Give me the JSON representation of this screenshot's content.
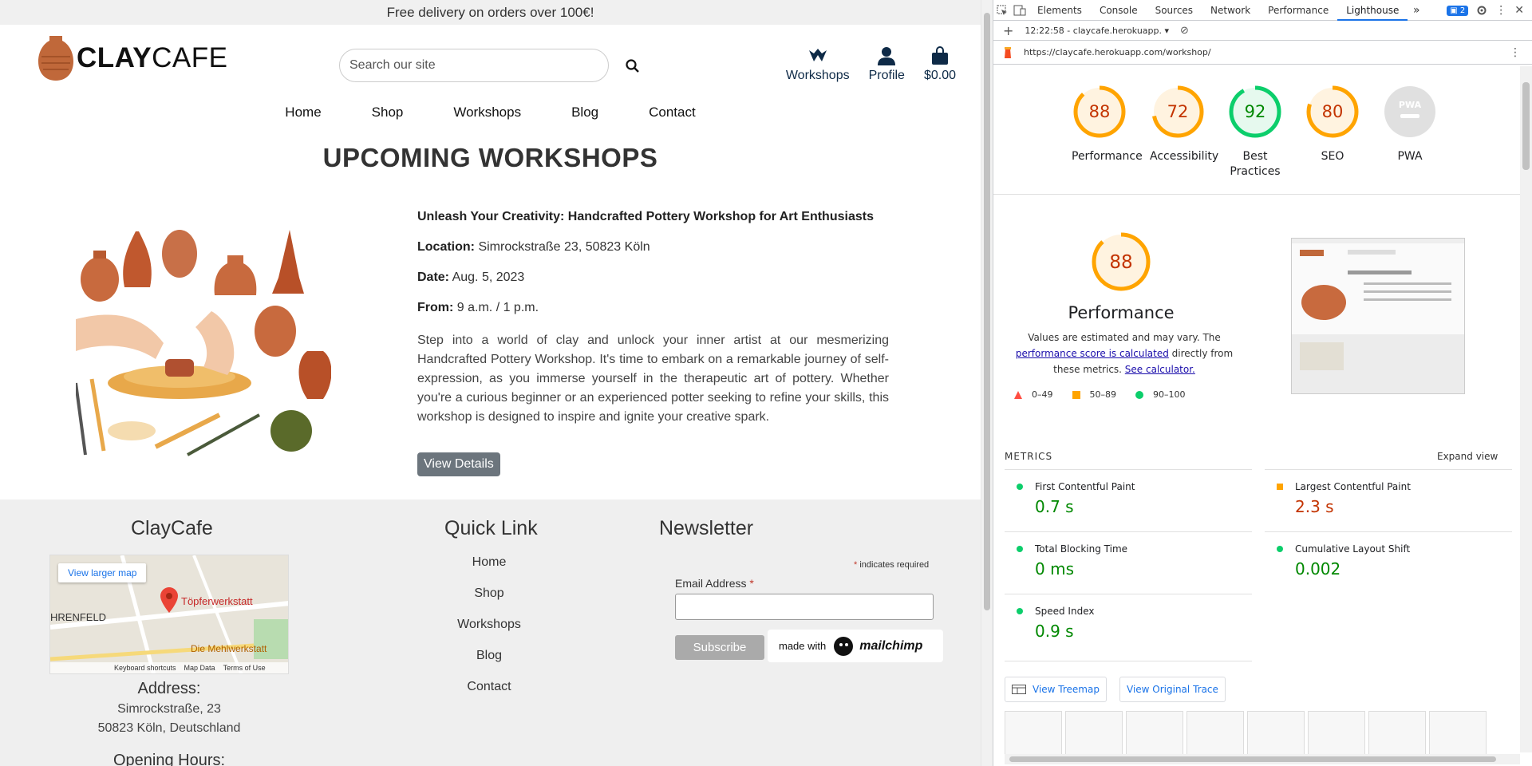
{
  "site": {
    "banner": "Free delivery on orders over 100€!",
    "logo": {
      "bold": "CLAY",
      "light": "CAFE"
    },
    "search": {
      "placeholder": "Search our site"
    },
    "nav_icons": [
      {
        "label": "Workshops",
        "icon": "pottery-icon"
      },
      {
        "label": "Profile",
        "icon": "user-icon"
      },
      {
        "label": "$0.00",
        "icon": "bag-icon"
      }
    ],
    "main_nav": [
      "Home",
      "Shop",
      "Workshops",
      "Blog",
      "Contact"
    ],
    "page_title": "UPCOMING WORKSHOPS",
    "workshop": {
      "title": "Unleash Your Creativity: Handcrafted Pottery Workshop for Art Enthusiasts",
      "location_label": "Location:",
      "location": "Simrockstraße 23, 50823 Köln",
      "date_label": "Date:",
      "date": "Aug. 5, 2023",
      "from_label": "From:",
      "from": "9 a.m. / 1 p.m.",
      "description": "Step into a world of clay and unlock your inner artist at our mesmerizing Handcrafted Pottery Workshop. It's time to embark on a remarkable journey of self-expression, as you immerse yourself in the therapeutic art of pottery. Whether you're a curious beginner or an experienced potter seeking to refine your skills, this workshop is designed to inspire and ignite your creative spark.",
      "button": "View Details"
    },
    "footer": {
      "col1_title": "ClayCafe",
      "map": {
        "button": "View larger map",
        "place": "Töpferwerkstatt",
        "place2": "Die Mehlwerkstatt",
        "area": "HRENFELD",
        "footer": [
          "Keyboard shortcuts",
          "Map Data",
          "Terms of Use"
        ]
      },
      "address_title": "Address:",
      "address_line1": "Simrockstraße, 23",
      "address_line2": "50823 Köln, Deutschland",
      "hours_title": "Opening Hours:",
      "col2_title": "Quick Link",
      "quick_links": [
        "Home",
        "Shop",
        "Workshops",
        "Blog",
        "Contact"
      ],
      "col3_title": "Newsletter",
      "required_note": "indicates required",
      "email_label": "Email Address",
      "subscribe": "Subscribe",
      "made_with": "made with",
      "mailchimp": "mailchimp"
    }
  },
  "devtools": {
    "tabs": [
      "Elements",
      "Console",
      "Sources",
      "Network",
      "Performance",
      "Lighthouse"
    ],
    "active_tab": "Lighthouse",
    "issues_count": "2",
    "report_label": "12:22:58 - claycafe.herokuapp.",
    "url": "https://claycafe.herokuapp.com/workshop/",
    "colors": {
      "pass": "#0cce6b",
      "average": "#ffa400",
      "fail": "#ff4e42",
      "average_text": "#c33300",
      "pass_text": "#008800"
    },
    "scores": [
      {
        "label": "Performance",
        "score": 88,
        "status": "average"
      },
      {
        "label": "Accessibility",
        "score": 72,
        "status": "average"
      },
      {
        "label": "Best Practices",
        "score": 92,
        "status": "pass"
      },
      {
        "label": "SEO",
        "score": 80,
        "status": "average"
      },
      {
        "label": "PWA",
        "score": null,
        "status": "na"
      }
    ],
    "performance": {
      "score": 88,
      "title": "Performance",
      "note_a": "Values are estimated and may vary. The ",
      "note_link1": "performance score is calculated",
      "note_b": " directly from these metrics. ",
      "note_link2": "See calculator.",
      "legend": [
        "0–49",
        "50–89",
        "90–100"
      ]
    },
    "metrics_header": "METRICS",
    "expand_view": "Expand view",
    "metrics": [
      {
        "name": "First Contentful Paint",
        "value": "0.7 s",
        "status": "pass"
      },
      {
        "name": "Largest Contentful Paint",
        "value": "2.3 s",
        "status": "average"
      },
      {
        "name": "Total Blocking Time",
        "value": "0 ms",
        "status": "pass"
      },
      {
        "name": "Cumulative Layout Shift",
        "value": "0.002",
        "status": "pass"
      },
      {
        "name": "Speed Index",
        "value": "0.9 s",
        "status": "pass"
      }
    ],
    "buttons": {
      "treemap": "View Treemap",
      "trace": "View Original Trace"
    }
  }
}
